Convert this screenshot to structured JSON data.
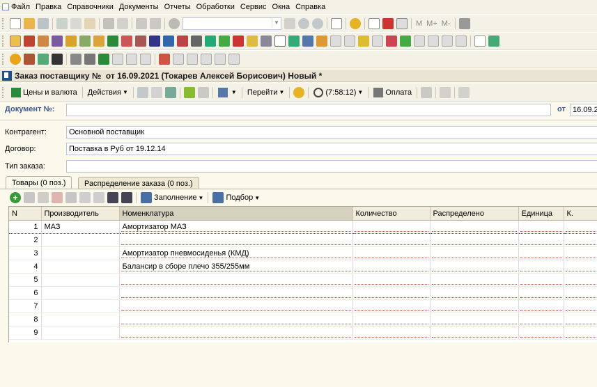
{
  "menubar": {
    "items": [
      "Файл",
      "Правка",
      "Справочники",
      "Документы",
      "Отчеты",
      "Обработки",
      "Сервис",
      "Окна",
      "Справка"
    ]
  },
  "toolbar": {
    "calc_labels": [
      "M",
      "M+",
      "M-"
    ]
  },
  "document": {
    "title": "Заказ поставщику №  от 16.09.2021 (Токарев Алексей Борисович) Новый *",
    "toolbar": {
      "prices": "Цены и валюта",
      "actions": "Действия",
      "goto": "Перейти",
      "time": "(7:58:12)",
      "payment": "Оплата"
    },
    "number_label": "Документ №:",
    "number_value": "",
    "date_label": "от",
    "date_value": "16.09.2",
    "contractor_label": "Контрагент:",
    "contractor_value": "Основной поставщик",
    "contract_label": "Договор:",
    "contract_value": "Поставка в Руб от 19.12.14",
    "order_type_label": "Тип заказа:",
    "order_type_value": ""
  },
  "tabs": [
    {
      "label": "Товары (0 поз.)"
    },
    {
      "label": "Распределение заказа (0 поз.)"
    }
  ],
  "grid_toolbar": {
    "fill": "Заполнение",
    "pick": "Подбор"
  },
  "table": {
    "columns": [
      "N",
      "Производитель",
      "Номенклатура",
      "Количество",
      "Распределено",
      "Единица",
      "К."
    ],
    "rows": [
      {
        "n": "1",
        "maker": "МАЗ",
        "item": "Амортизатор МАЗ"
      },
      {
        "n": "2",
        "maker": "",
        "item": ""
      },
      {
        "n": "3",
        "maker": "",
        "item": "Амортизатор пневмосиденья (КМД)"
      },
      {
        "n": "4",
        "maker": "",
        "item": "Балансир в сборе плечо 355/255мм"
      },
      {
        "n": "5",
        "maker": "",
        "item": ""
      },
      {
        "n": "6",
        "maker": "",
        "item": ""
      },
      {
        "n": "7",
        "maker": "",
        "item": ""
      },
      {
        "n": "8",
        "maker": "",
        "item": ""
      },
      {
        "n": "9",
        "maker": "",
        "item": ""
      }
    ]
  }
}
